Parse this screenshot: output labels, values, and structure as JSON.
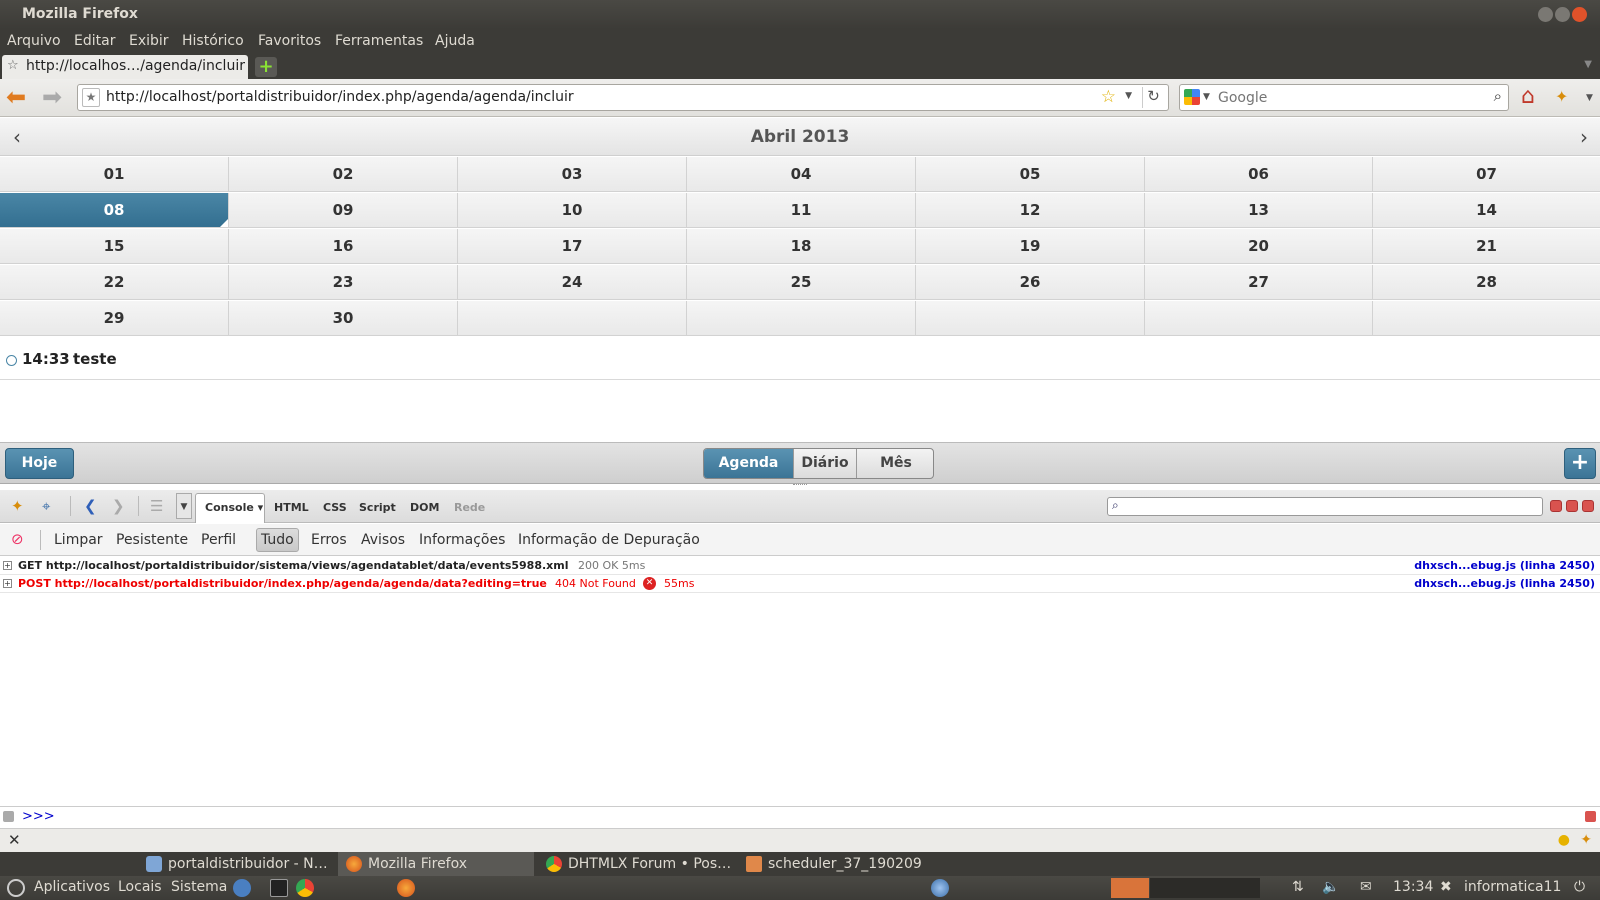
{
  "window": {
    "title": "Mozilla Firefox"
  },
  "menu": [
    "Arquivo",
    "Editar",
    "Exibir",
    "Histórico",
    "Favoritos",
    "Ferramentas",
    "Ajuda"
  ],
  "tab": {
    "label": "http://localhos…/agenda/incluir"
  },
  "navbar": {
    "url": "http://localhost/portaldistribuidor/index.php/agenda/agenda/incluir",
    "search_placeholder": "Google"
  },
  "scheduler": {
    "month_title": "Abril 2013",
    "days": [
      [
        "01",
        "02",
        "03",
        "04",
        "05",
        "06",
        "07"
      ],
      [
        "08",
        "09",
        "10",
        "11",
        "12",
        "13",
        "14"
      ],
      [
        "15",
        "16",
        "17",
        "18",
        "19",
        "20",
        "21"
      ],
      [
        "22",
        "23",
        "24",
        "25",
        "26",
        "27",
        "28"
      ],
      [
        "29",
        "30",
        "",
        "",
        "",
        "",
        ""
      ]
    ],
    "selected_day": "08",
    "events": [
      {
        "time": "14:33",
        "text": "teste"
      }
    ],
    "toolbar": {
      "today_label": "Hoje",
      "views": [
        "Agenda",
        "Diário",
        "Mês"
      ],
      "active_view": "Agenda",
      "add_label": "+"
    }
  },
  "firebug": {
    "panels": [
      "Console",
      "HTML",
      "CSS",
      "Script",
      "DOM",
      "Rede"
    ],
    "active_panel": "Console",
    "filters": [
      "Limpar",
      "Pesistente",
      "Perfil",
      "Tudo",
      "Erros",
      "Avisos",
      "Informações",
      "Informação de Depuração"
    ],
    "active_filter": "Tudo",
    "log": [
      {
        "request": "GET http://localhost/portaldistribuidor/sistema/views/agendatablet/data/events5988.xml",
        "status": "200 OK 5ms",
        "source": "dhxsch...ebug.js (linha 2450)",
        "error": false
      },
      {
        "request": "POST http://localhost/portaldistribuidor/index.php/agenda/agenda/data?editing=true",
        "status": "404 Not Found",
        "time": "55ms",
        "source": "dhxsch...ebug.js (linha 2450)",
        "error": true
      }
    ],
    "prompt": ">>>"
  },
  "taskbar": {
    "windows": [
      "portaldistribuidor - N…",
      "Mozilla Firefox",
      "DHTMLX Forum • Pos…",
      "scheduler_37_190209"
    ]
  },
  "panel": {
    "menus": [
      "Aplicativos",
      "Locais",
      "Sistema"
    ],
    "clock": "13:34",
    "user": "informatica11"
  },
  "colors": {
    "accent": "#3b7496",
    "error": "#e00000",
    "link": "#0000cc"
  }
}
